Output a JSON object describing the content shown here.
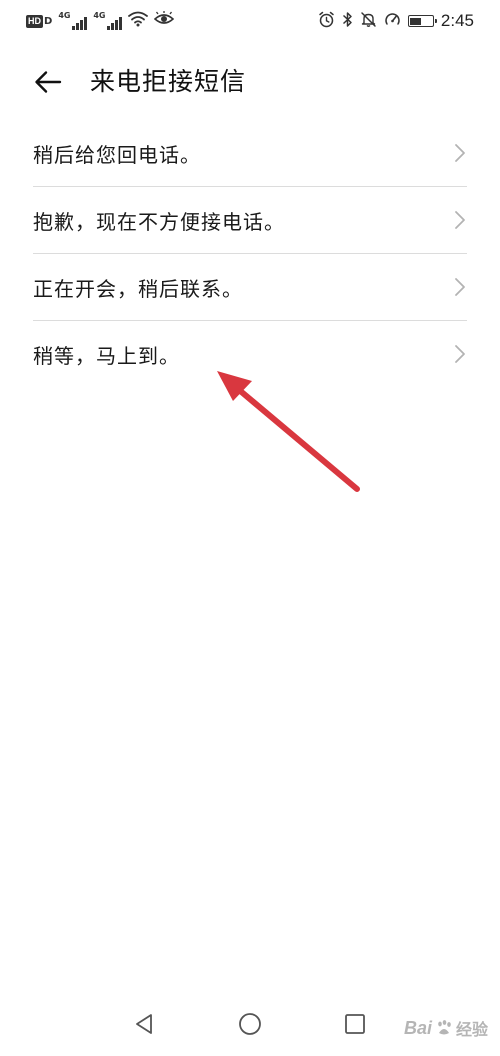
{
  "status_bar": {
    "time": "2:45",
    "network_label": "4G",
    "hd_label": "HD",
    "hd_suffix": "D",
    "battery_level": 0.55
  },
  "header": {
    "title": "来电拒接短信"
  },
  "replies": [
    {
      "text": "稍后给您回电话。"
    },
    {
      "text": "抱歉，现在不方便接电话。"
    },
    {
      "text": "正在开会，稍后联系。"
    },
    {
      "text": "稍等，马上到。"
    }
  ],
  "watermark": {
    "brand": "Bai",
    "suffix": "经验"
  },
  "colors": {
    "annotation_arrow": "#d9373f",
    "divider": "#dcdcdc",
    "chevron": "#b3b3b3"
  }
}
